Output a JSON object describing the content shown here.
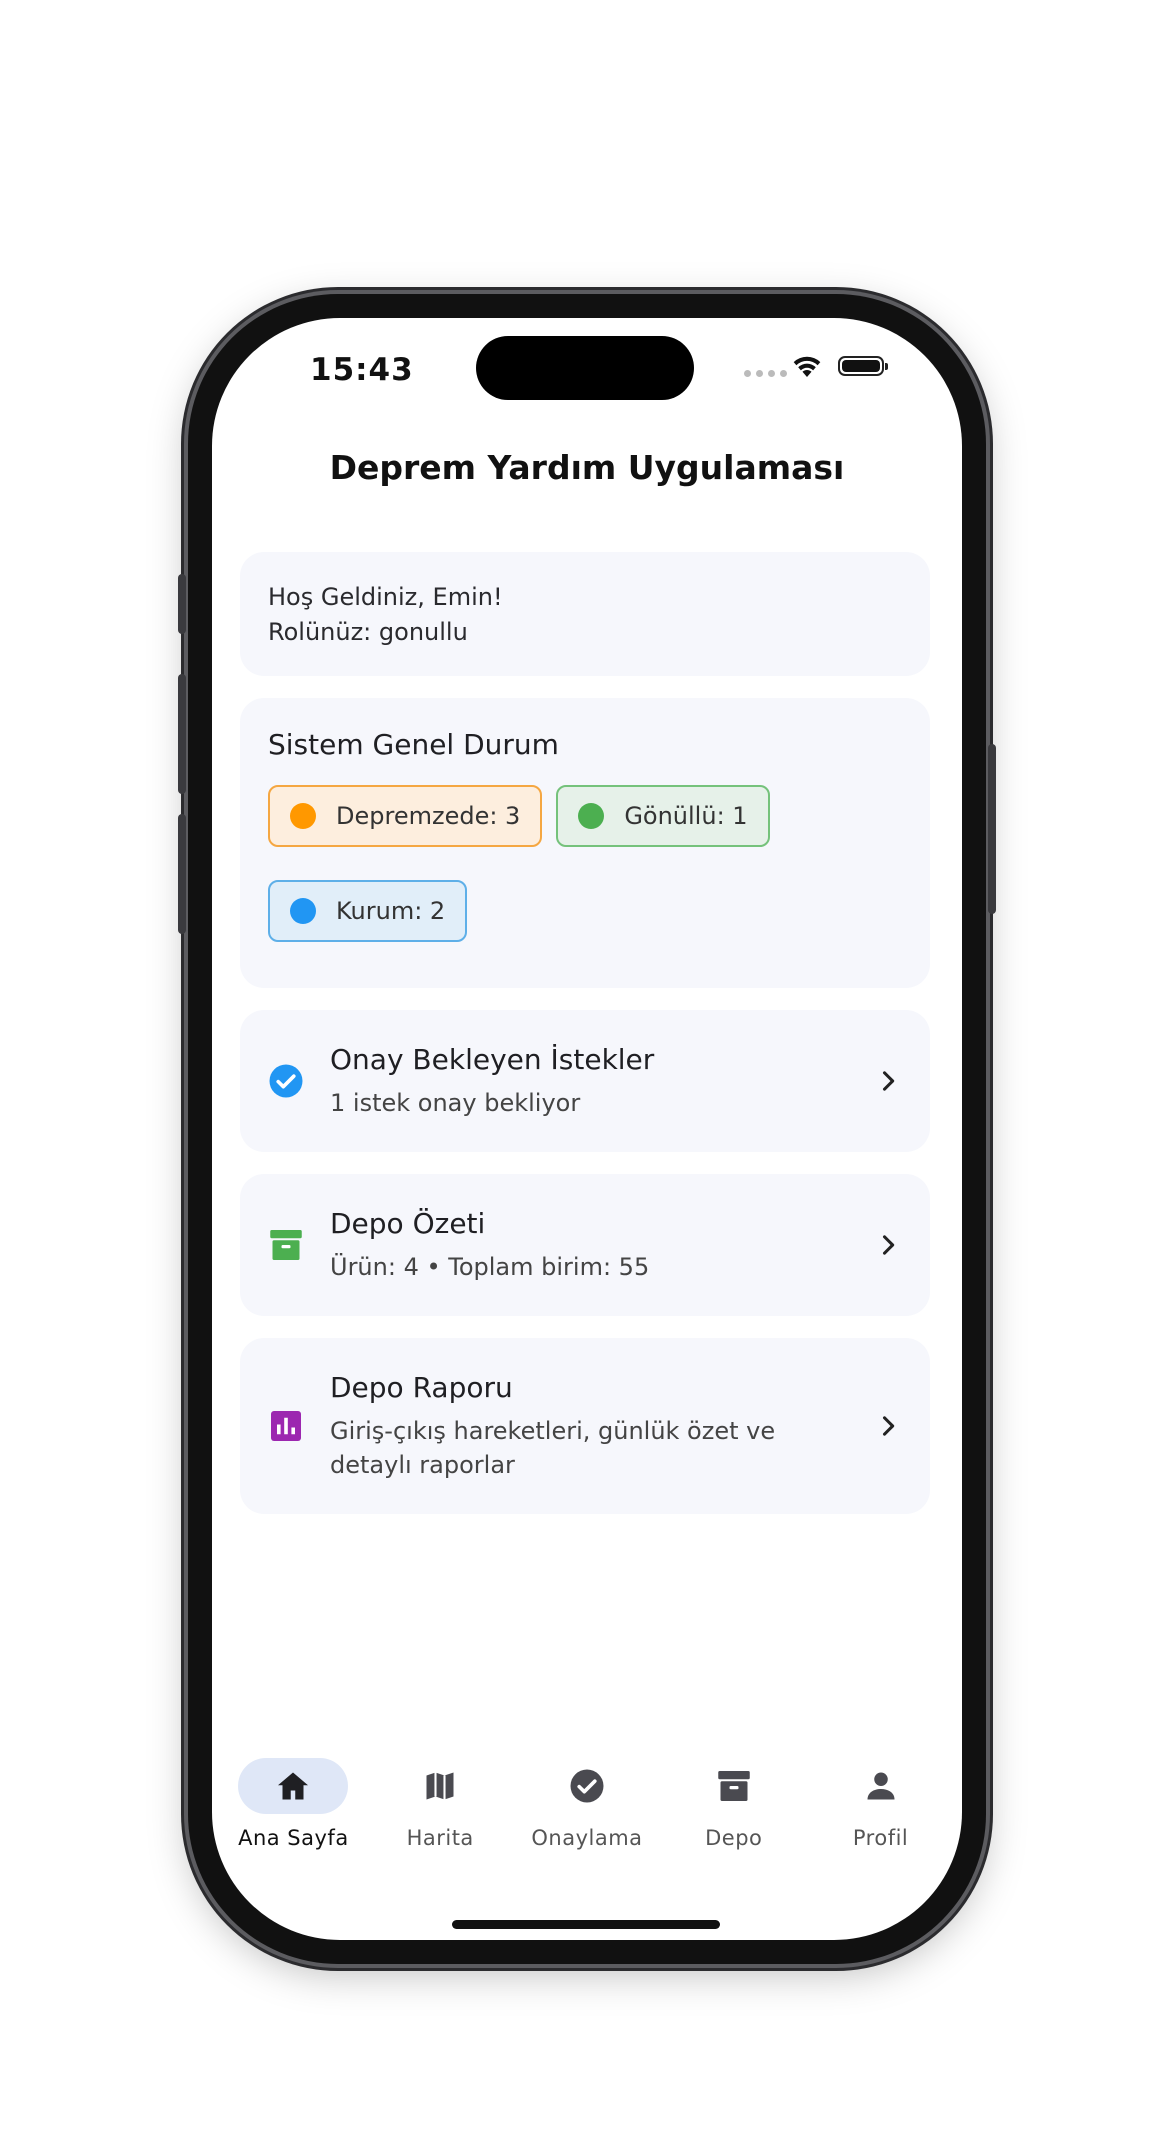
{
  "status_bar": {
    "time": "15:43"
  },
  "app": {
    "title": "Deprem Yardım Uygulaması"
  },
  "welcome": {
    "greeting": "Hoş Geldiniz, Emin!",
    "role": "Rolünüz: gonullu"
  },
  "system_status": {
    "title": "Sistem Genel Durum",
    "chips": [
      {
        "label": "Depremzede: 3",
        "color": "#ff9800"
      },
      {
        "label": "Gönüllü: 1",
        "color": "#4caf50"
      },
      {
        "label": "Kurum: 2",
        "color": "#2196f3"
      }
    ]
  },
  "cards": [
    {
      "title": "Onay Bekleyen İstekler",
      "subtitle": "1 istek onay bekliyor",
      "icon": "check-circle-icon",
      "color": "#2196f3"
    },
    {
      "title": "Depo Özeti",
      "subtitle": "Ürün: 4 • Toplam birim: 55",
      "icon": "archive-icon",
      "color": "#4caf50"
    },
    {
      "title": "Depo Raporu",
      "subtitle": "Giriş-çıkış hareketleri, günlük özet ve detaylı raporlar",
      "icon": "bar-chart-icon",
      "color": "#9c27b0"
    }
  ],
  "nav": {
    "items": [
      {
        "label": "Ana Sayfa",
        "icon": "home-icon",
        "active": true
      },
      {
        "label": "Harita",
        "icon": "map-icon"
      },
      {
        "label": "Onaylama",
        "icon": "check-circle-icon"
      },
      {
        "label": "Depo",
        "icon": "archive-icon"
      },
      {
        "label": "Profil",
        "icon": "person-icon"
      }
    ]
  }
}
